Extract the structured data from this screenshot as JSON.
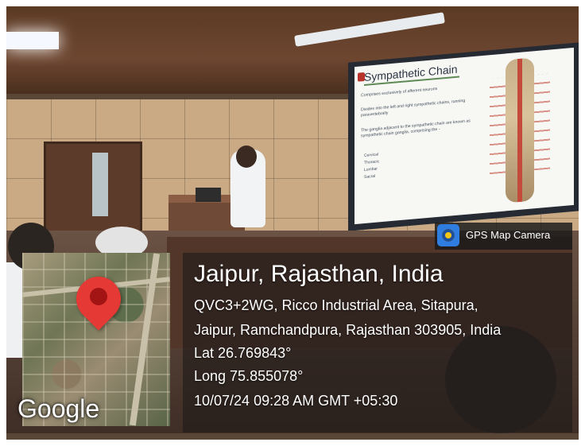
{
  "scene": {
    "slide": {
      "title": "Sympathetic Chain",
      "bullets": [
        "Comprises exclusively of afferent neurons",
        "Divides into the left and right sympathetic chains, running paravertebrally",
        "The ganglia adjacent to the sympathetic chain are known as sympathetic chain ganglia, comprising the -"
      ],
      "list": [
        "Cervical",
        "Thoracic",
        "Lumbar",
        "Sacral"
      ]
    }
  },
  "overlay": {
    "app_name": "GPS Map Camera",
    "map_brand": "Google",
    "location_title": "Jaipur, Rajasthan, India",
    "address_line_1": "QVC3+2WG, Ricco Industrial Area, Sitapura,",
    "address_line_2": "Jaipur, Ramchandpura, Rajasthan 303905, India",
    "latitude": "Lat 26.769843°",
    "longitude": "Long 75.855078°",
    "timestamp": "10/07/24 09:28 AM GMT +05:30"
  },
  "icons": {
    "map_pin": "map-pin-icon",
    "app_logo": "camera-app-icon"
  },
  "colors": {
    "pin_red": "#e53935",
    "overlay_bg": "#1e1a18"
  }
}
